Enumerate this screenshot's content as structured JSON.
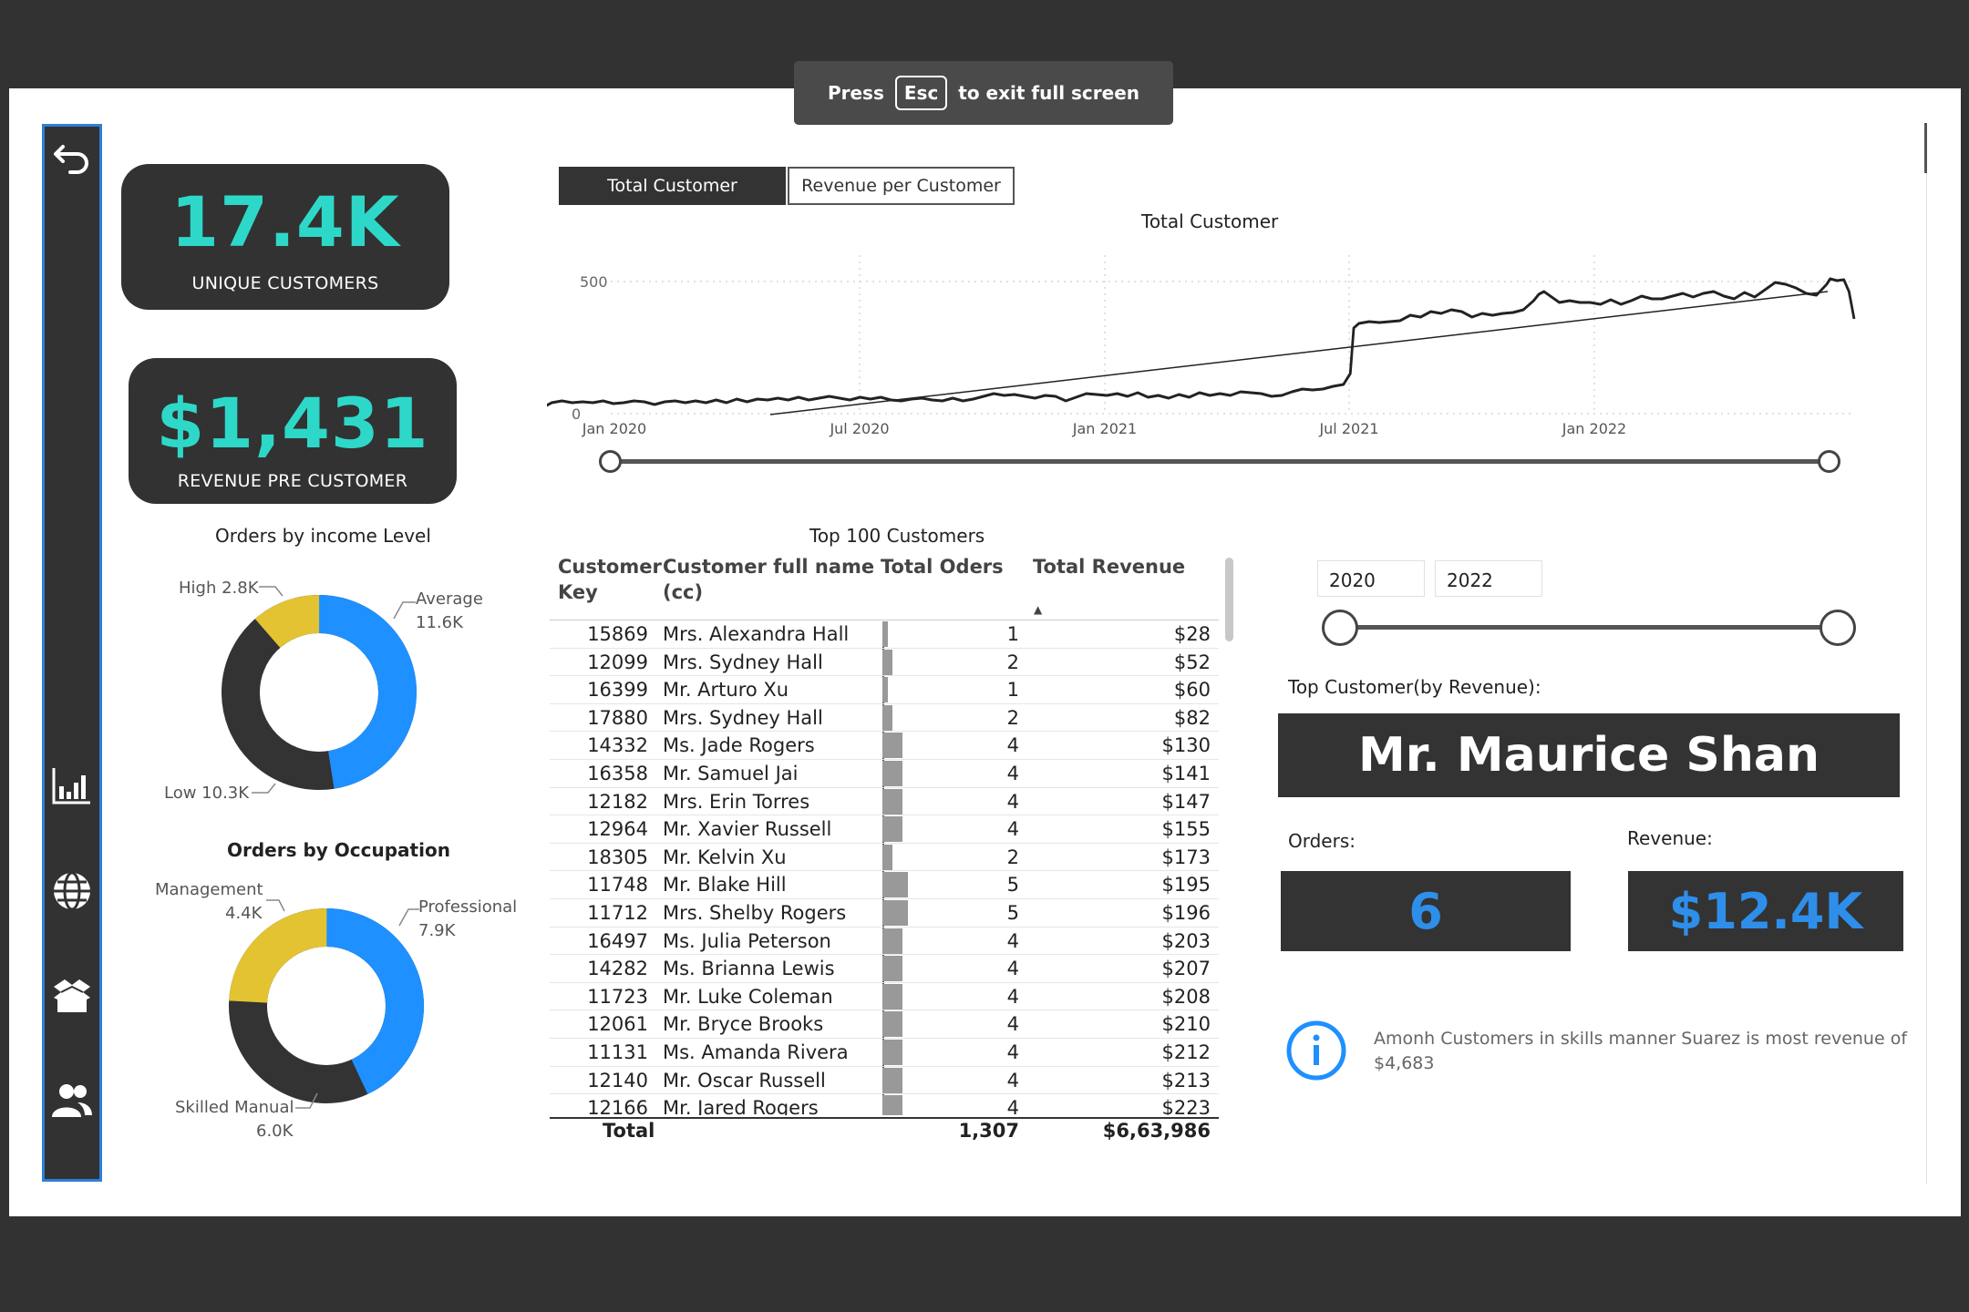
{
  "fullscreen": {
    "press": "Press",
    "key": "Esc",
    "rest": "to exit full screen"
  },
  "nav": {
    "icons": [
      "back-arrow-icon",
      "bar-chart-icon",
      "globe-icon",
      "box-icon",
      "users-icon"
    ]
  },
  "kpis": {
    "customers": {
      "value": "17.4K",
      "label": "UNIQUE CUSTOMERS"
    },
    "revenue": {
      "value": "$1,431",
      "label": "REVENUE PRE CUSTOMER"
    }
  },
  "income_chart": {
    "title": "Orders by income Level",
    "labels": {
      "high": "High 2.8K",
      "avg_name": "Average",
      "avg_val": "11.6K",
      "low": "Low 10.3K"
    }
  },
  "occupation_chart": {
    "title": "Orders by Occupation",
    "labels": {
      "mgmt_name": "Management",
      "mgmt_val": "4.4K",
      "prof_name": "Professional",
      "prof_val": "7.9K",
      "skill_name": "Skilled Manual",
      "skill_val": "6.0K"
    }
  },
  "tabs": {
    "active": "Total Customer",
    "other": "Revenue per Customer"
  },
  "line_chart": {
    "title": "Total Customer",
    "y_ticks": [
      "500",
      "0"
    ],
    "x_ticks": [
      "Jan 2020",
      "Jul 2020",
      "Jan 2021",
      "Jul 2021",
      "Jan 2022"
    ]
  },
  "table": {
    "title": "Top 100 Customers",
    "headers": {
      "key1": "Customer",
      "key2": "Key",
      "name1": "Customer full name",
      "name2": "(cc)",
      "orders": "Total Oders",
      "revenue": "Total Revenue"
    },
    "rows": [
      {
        "key": "15869",
        "name": "Mrs. Alexandra Hall",
        "orders": "1",
        "revenue": "$28"
      },
      {
        "key": "12099",
        "name": "Mrs. Sydney Hall",
        "orders": "2",
        "revenue": "$52"
      },
      {
        "key": "16399",
        "name": "Mr. Arturo Xu",
        "orders": "1",
        "revenue": "$60"
      },
      {
        "key": "17880",
        "name": "Mrs. Sydney Hall",
        "orders": "2",
        "revenue": "$82"
      },
      {
        "key": "14332",
        "name": "Ms. Jade Rogers",
        "orders": "4",
        "revenue": "$130"
      },
      {
        "key": "16358",
        "name": "Mr. Samuel Jai",
        "orders": "4",
        "revenue": "$141"
      },
      {
        "key": "12182",
        "name": "Mrs. Erin Torres",
        "orders": "4",
        "revenue": "$147"
      },
      {
        "key": "12964",
        "name": "Mr. Xavier Russell",
        "orders": "4",
        "revenue": "$155"
      },
      {
        "key": "18305",
        "name": "Mr. Kelvin Xu",
        "orders": "2",
        "revenue": "$173"
      },
      {
        "key": "11748",
        "name": "Mr. Blake Hill",
        "orders": "5",
        "revenue": "$195"
      },
      {
        "key": "11712",
        "name": "Mrs. Shelby Rogers",
        "orders": "5",
        "revenue": "$196"
      },
      {
        "key": "16497",
        "name": "Ms. Julia Peterson",
        "orders": "4",
        "revenue": "$203"
      },
      {
        "key": "14282",
        "name": "Ms. Brianna Lewis",
        "orders": "4",
        "revenue": "$207"
      },
      {
        "key": "11723",
        "name": "Mr. Luke Coleman",
        "orders": "4",
        "revenue": "$208"
      },
      {
        "key": "12061",
        "name": "Mr. Bryce Brooks",
        "orders": "4",
        "revenue": "$210"
      },
      {
        "key": "11131",
        "name": "Ms. Amanda Rivera",
        "orders": "4",
        "revenue": "$212"
      },
      {
        "key": "12140",
        "name": "Mr. Oscar Russell",
        "orders": "4",
        "revenue": "$213"
      },
      {
        "key": "12166",
        "name": "Mr. Jared Rogers",
        "orders": "4",
        "revenue": "$223"
      }
    ],
    "total": {
      "label": "Total",
      "orders": "1,307",
      "revenue": "$6,63,986"
    }
  },
  "year_filter": {
    "from": "2020",
    "to": "2022"
  },
  "top_customer": {
    "label": "Top Customer(by Revenue):",
    "name": "Mr. Maurice Shan",
    "orders_label": "Orders:",
    "orders_value": "6",
    "revenue_label": "Revenue:",
    "revenue_value": "$12.4K"
  },
  "info": {
    "line1": "Amonh Customers in skills manner Suarez is most revenue of",
    "line2": "$4,683"
  },
  "colors": {
    "accent_teal": "#2ed8c9",
    "accent_blue": "#1e90ff",
    "yellow": "#e3c332",
    "dark": "#323232"
  }
}
